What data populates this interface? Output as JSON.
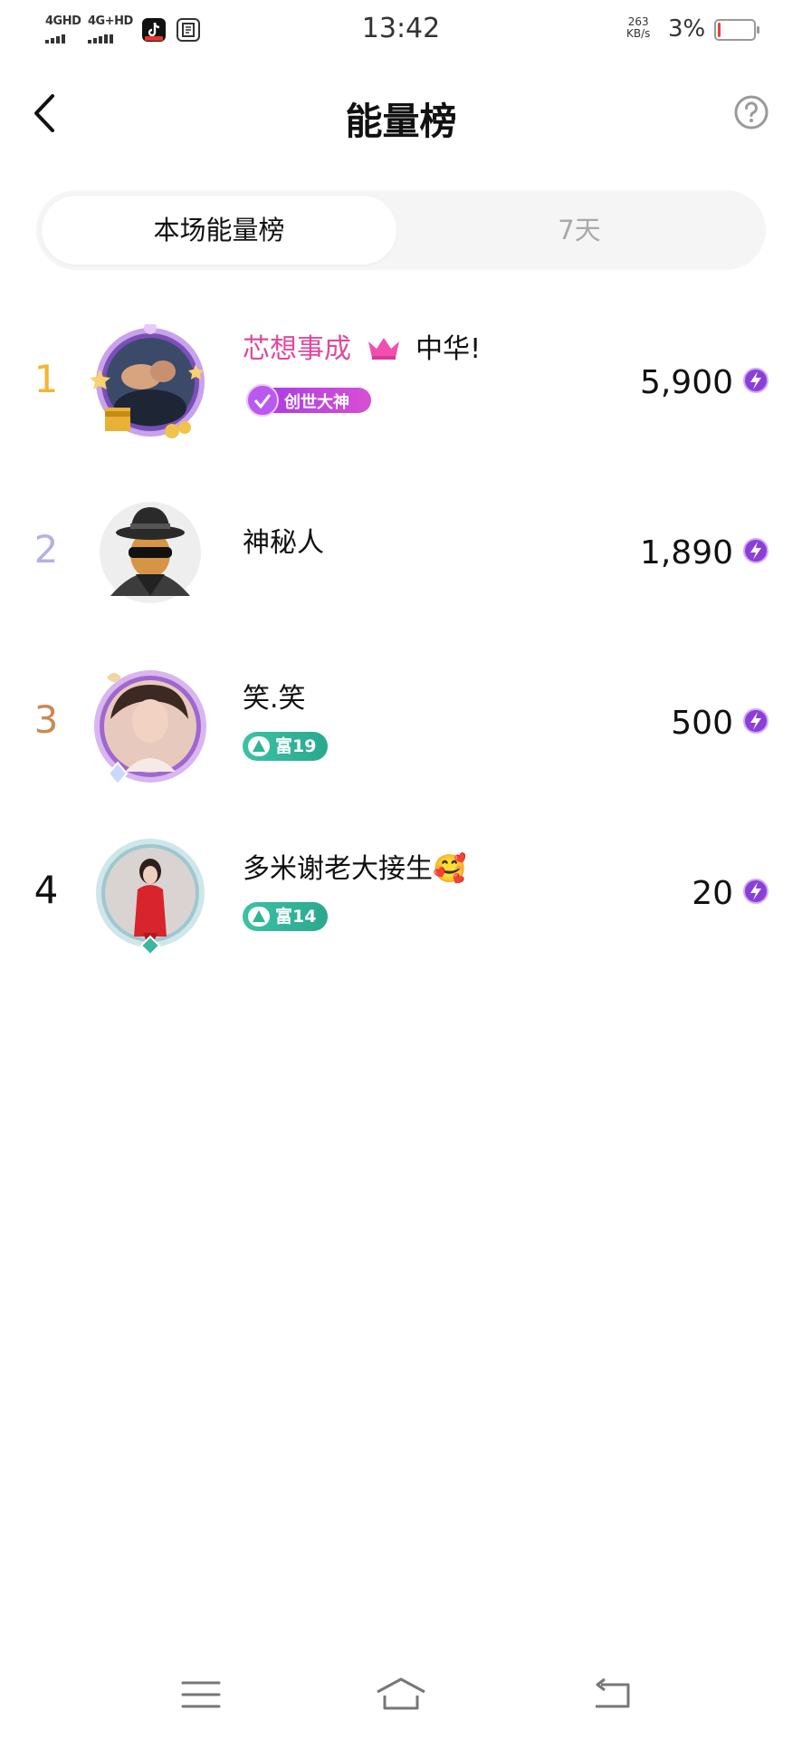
{
  "status_bar": {
    "net1": "4GHD",
    "net2": "4G+HD",
    "time": "13:42",
    "speed_value": "263",
    "speed_unit": "KB/s",
    "battery_percent": "3%",
    "battery_level": 0.03
  },
  "header": {
    "title": "能量榜",
    "back_icon": "chevron-left-icon",
    "help_icon": "question-circle-icon"
  },
  "tabs": [
    {
      "label": "本场能量榜",
      "active": true
    },
    {
      "label": "7天",
      "active": false
    }
  ],
  "rankings": [
    {
      "rank": "1",
      "rank_color": "#f2b530",
      "name_pink": "芯想事成",
      "name_rest": "中华!",
      "badge": "创世大神",
      "score": "5,900"
    },
    {
      "rank": "2",
      "rank_color": "#b4b1e6",
      "name": "神秘人",
      "score": "1,890"
    },
    {
      "rank": "3",
      "rank_color": "#c98a55",
      "name": "笑.笑",
      "badge": "富19",
      "score": "500"
    },
    {
      "rank": "4",
      "rank_color": "#111111",
      "name": "多米谢老大接生🥰",
      "badge": "富14",
      "score": "20"
    }
  ],
  "nav_bar": {
    "menu_icon": "menu-icon",
    "home_icon": "home-icon",
    "back_icon": "return-icon"
  },
  "colors": {
    "accent_pink": "#e0489e",
    "energy_purple": "#8a3fd6",
    "rich_badge": "#2fb496"
  }
}
